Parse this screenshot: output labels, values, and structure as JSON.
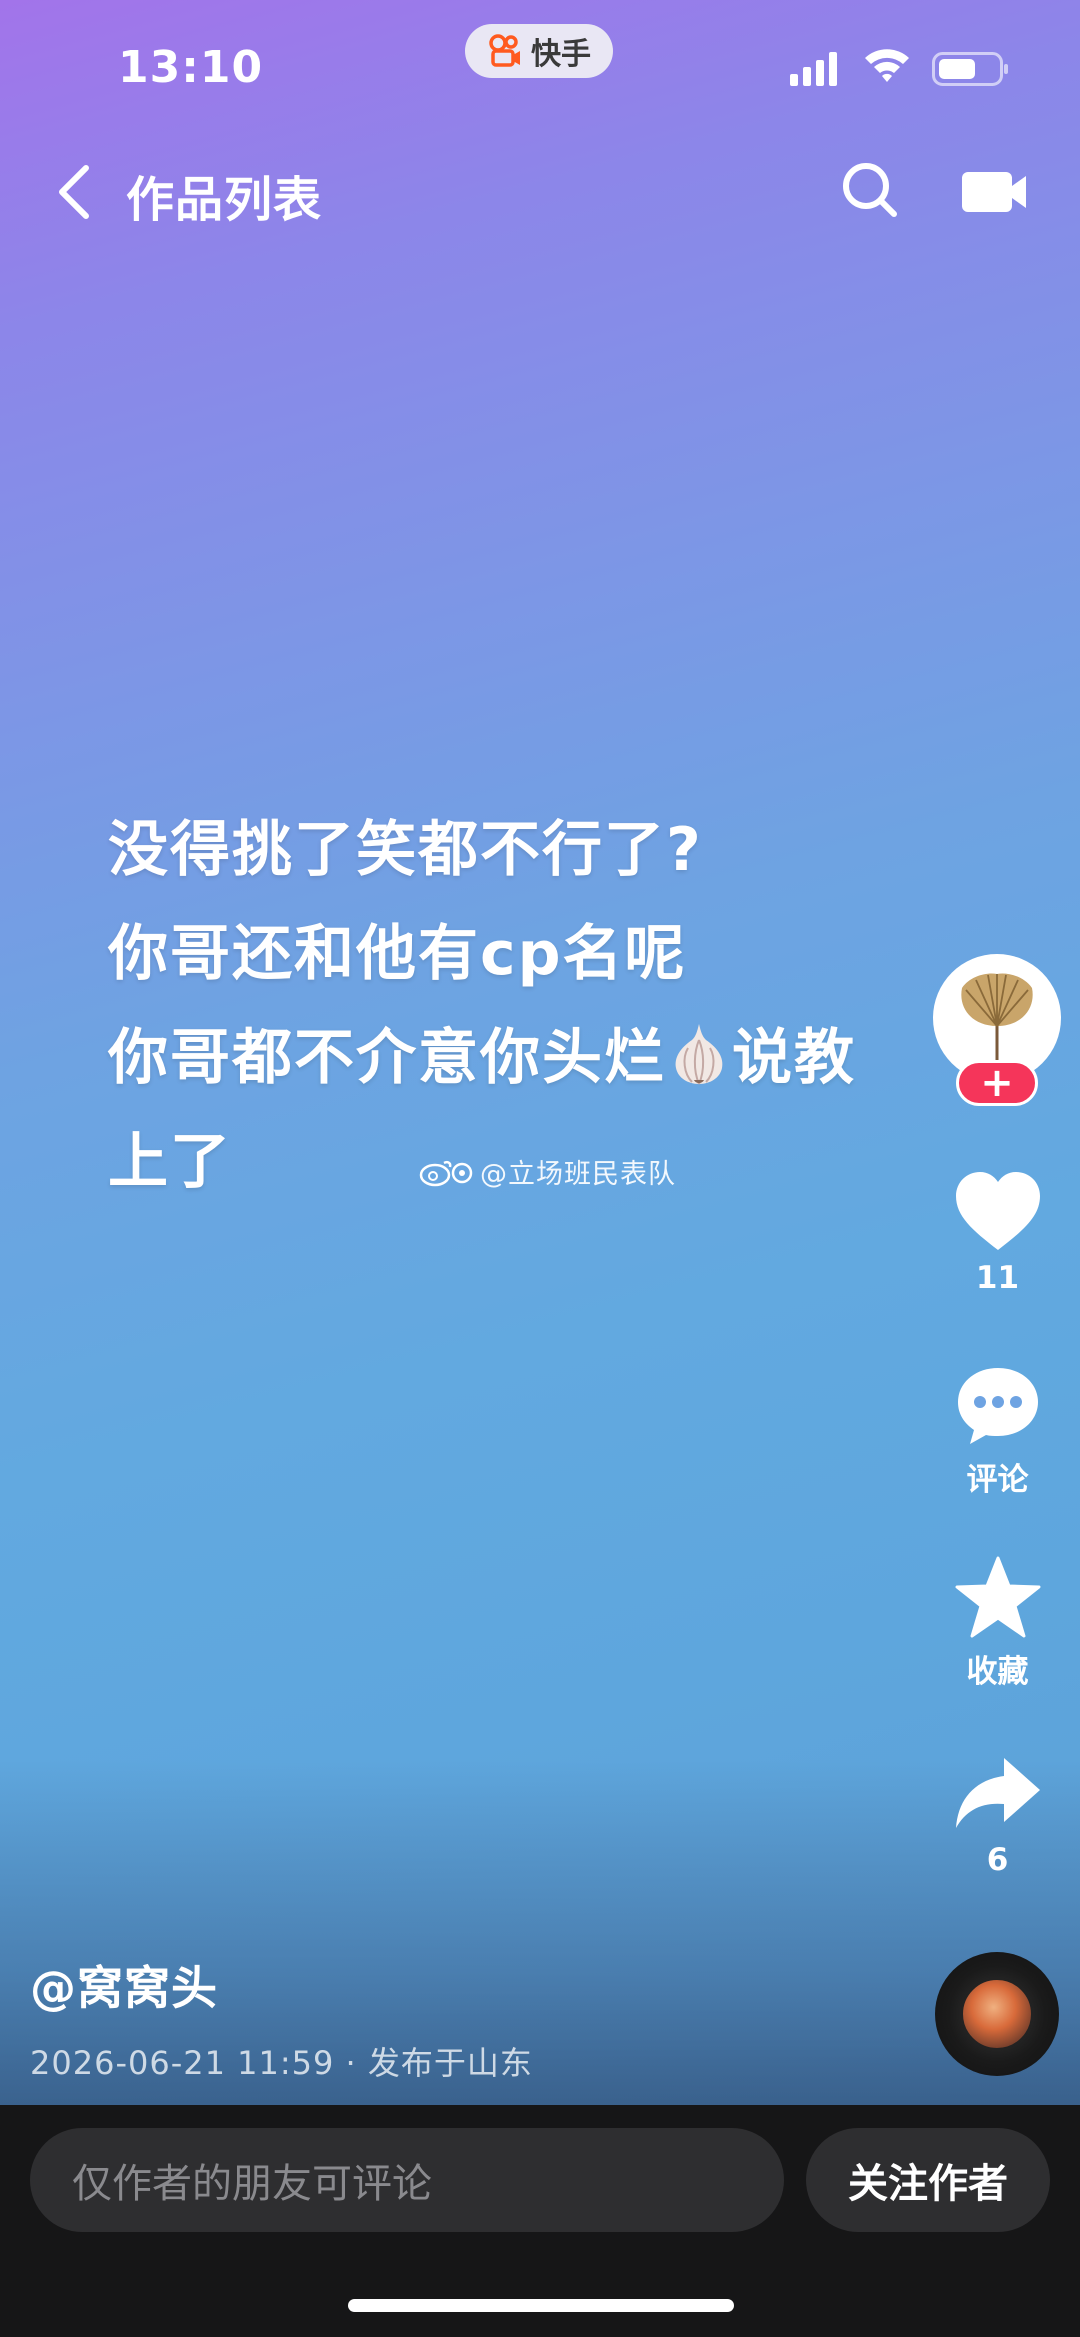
{
  "status_bar": {
    "time": "13:10",
    "app_pill_label": "快手"
  },
  "nav": {
    "title": "作品列表",
    "back_icon": "back-chevron-icon",
    "search_icon": "search-icon",
    "camera_icon": "camera-icon"
  },
  "caption": {
    "lines": [
      "没得挑了笑都不行了?",
      "你哥还和他有cp名呢",
      "你哥都不介意你头烂",
      "说教",
      "上了"
    ],
    "emoji": "garlic-icon"
  },
  "watermark": "@立场班民表队",
  "actions": {
    "likes": "11",
    "comment_label": "评论",
    "favorite_label": "收藏",
    "shares": "6",
    "follow_plus": "+"
  },
  "post": {
    "author": "@窝窝头",
    "meta": "2026-06-21 11:59 · 发布于山东"
  },
  "bottom": {
    "comment_placeholder": "仅作者的朋友可评论",
    "follow_button": "关注作者"
  },
  "colors": {
    "gradient_top": "#a274ea",
    "gradient_bottom": "#5b9fd5",
    "follow_badge": "#f5355a",
    "bottom_bar": "#161617"
  }
}
